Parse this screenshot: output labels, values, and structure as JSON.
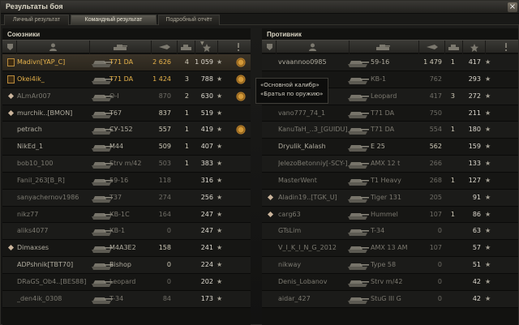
{
  "window": {
    "title": "Результаты боя"
  },
  "tabs": [
    {
      "label": "Личный результат"
    },
    {
      "label": "Командный результат"
    },
    {
      "label": "Подробный отчёт"
    }
  ],
  "allies": {
    "title": "Союзники",
    "rows": [
      {
        "player": "Madivn[YAP_C]",
        "tank": "T71 DA",
        "dmg": "2 626",
        "frags": "4",
        "xp": "1 059",
        "mark": "platoon",
        "style": "hl",
        "award": true
      },
      {
        "player": "Okei4ik_",
        "tank": "T71 DA",
        "dmg": "1 424",
        "frags": "3",
        "xp": "788",
        "mark": "platoon",
        "style": "gold",
        "award": true
      },
      {
        "player": "ALmAr007",
        "tank": "O-I",
        "dmg": "870",
        "frags": "2",
        "xp": "630",
        "mark": "medal",
        "style": "dim",
        "award": true
      },
      {
        "player": "murchik..[BMON]",
        "tank": "T67",
        "dmg": "837",
        "frags": "1",
        "xp": "519",
        "mark": "medal",
        "style": "normal",
        "award": false
      },
      {
        "player": "petrach",
        "tank": "СУ-152",
        "dmg": "557",
        "frags": "1",
        "xp": "419",
        "mark": "",
        "style": "normal",
        "award": true
      },
      {
        "player": "NikEd_1",
        "tank": "M44",
        "dmg": "509",
        "frags": "1",
        "xp": "407",
        "mark": "",
        "style": "normal",
        "award": false
      },
      {
        "player": "bob10_100",
        "tank": "Strv m/42",
        "dmg": "503",
        "frags": "1",
        "xp": "383",
        "mark": "",
        "style": "dim",
        "award": false
      },
      {
        "player": "Fanil_263[B_R]",
        "tank": "59-16",
        "dmg": "118",
        "frags": "",
        "xp": "316",
        "mark": "",
        "style": "dim",
        "award": false
      },
      {
        "player": "sanyachernov1986",
        "tank": "T37",
        "dmg": "274",
        "frags": "",
        "xp": "256",
        "mark": "",
        "style": "dim",
        "award": false
      },
      {
        "player": "nikz77",
        "tank": "КВ-1С",
        "dmg": "164",
        "frags": "",
        "xp": "247",
        "mark": "",
        "style": "dim",
        "award": false
      },
      {
        "player": "aliks4077",
        "tank": "КВ-1",
        "dmg": "0",
        "frags": "",
        "xp": "247",
        "mark": "",
        "style": "dim",
        "award": false
      },
      {
        "player": "Dimaxses",
        "tank": "M4A3E2",
        "dmg": "158",
        "frags": "",
        "xp": "241",
        "mark": "medal",
        "style": "normal",
        "award": false
      },
      {
        "player": "ADPshnik[TBT70]",
        "tank": "Bishop",
        "dmg": "0",
        "frags": "",
        "xp": "224",
        "mark": "",
        "style": "normal",
        "award": false
      },
      {
        "player": "DRaGS_Ob4..[BES88]",
        "tank": "Leopard",
        "dmg": "0",
        "frags": "",
        "xp": "202",
        "mark": "",
        "style": "dim",
        "award": false
      },
      {
        "player": "_den4ik_0308",
        "tank": "T-34",
        "dmg": "84",
        "frags": "",
        "xp": "173",
        "mark": "",
        "style": "dim",
        "award": false
      }
    ]
  },
  "enemies": {
    "title": "Противник",
    "rows": [
      {
        "player": "vvaannoo0985",
        "tank": "59-16",
        "dmg": "1 479",
        "frags": "1",
        "xp": "417",
        "mark": "",
        "style": "normal"
      },
      {
        "player": "",
        "tank": "КВ-1",
        "dmg": "762",
        "frags": "",
        "xp": "293",
        "mark": "",
        "style": "dim"
      },
      {
        "player": "",
        "tank": "Leopard",
        "dmg": "417",
        "frags": "3",
        "xp": "272",
        "mark": "",
        "style": "dim"
      },
      {
        "player": "vano777_74_1",
        "tank": "T71 DA",
        "dmg": "750",
        "frags": "",
        "xp": "211",
        "mark": "",
        "style": "dim"
      },
      {
        "player": "KanuTaH_..3_[GUIDU]",
        "tank": "T71 DA",
        "dmg": "554",
        "frags": "1",
        "xp": "180",
        "mark": "",
        "style": "dim"
      },
      {
        "player": "Dryulik_Kalash",
        "tank": "E 25",
        "dmg": "562",
        "frags": "",
        "xp": "159",
        "mark": "",
        "style": "normal"
      },
      {
        "player": "JelezoBetonniy[-SCY-]",
        "tank": "AMX 12 t",
        "dmg": "266",
        "frags": "",
        "xp": "133",
        "mark": "",
        "style": "dim"
      },
      {
        "player": "MasterWent",
        "tank": "T1 Heavy",
        "dmg": "268",
        "frags": "1",
        "xp": "127",
        "mark": "",
        "style": "dim"
      },
      {
        "player": "Aladin19..[TGK_U]",
        "tank": "Tiger 131",
        "dmg": "205",
        "frags": "",
        "xp": "91",
        "mark": "medal",
        "style": "dim"
      },
      {
        "player": "carg63",
        "tank": "Hummel",
        "dmg": "107",
        "frags": "1",
        "xp": "86",
        "mark": "medal",
        "style": "dim"
      },
      {
        "player": "GTsLim",
        "tank": "T-34",
        "dmg": "0",
        "frags": "",
        "xp": "63",
        "mark": "",
        "style": "dim"
      },
      {
        "player": "V_I_K_I_N_G_2012",
        "tank": "AMX 13 AM",
        "dmg": "107",
        "frags": "",
        "xp": "57",
        "mark": "",
        "style": "dim"
      },
      {
        "player": "nikway",
        "tank": "Type 58",
        "dmg": "0",
        "frags": "",
        "xp": "51",
        "mark": "",
        "style": "dim"
      },
      {
        "player": "Denis_Lobanov",
        "tank": "Strv m/42",
        "dmg": "0",
        "frags": "",
        "xp": "42",
        "mark": "",
        "style": "dim"
      },
      {
        "player": "aidar_427",
        "tank": "StuG III G",
        "dmg": "0",
        "frags": "",
        "xp": "42",
        "mark": "",
        "style": "dim"
      }
    ]
  },
  "tooltip": {
    "line1": "«Основной калибр»",
    "line2": "«Братья по оружию»"
  },
  "colors": {
    "gold": "#e6b24a",
    "dim": "#7c7a71",
    "text": "#b0ac9f",
    "highlight": "#3a3328"
  }
}
